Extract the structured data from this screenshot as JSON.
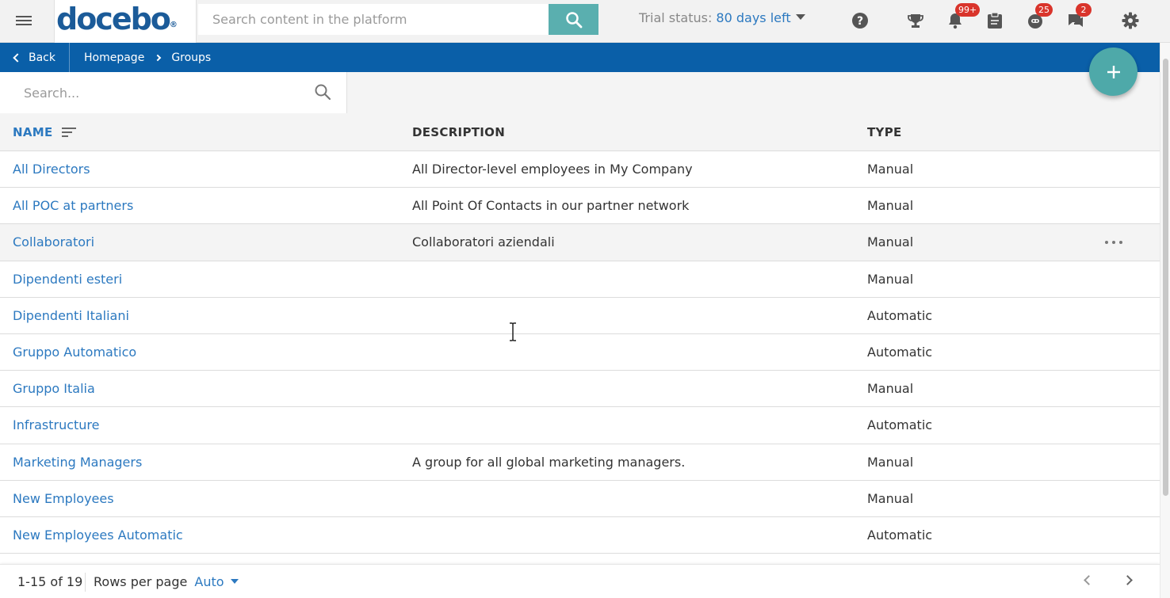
{
  "topbar": {
    "logo_text": "docebo",
    "logo_mark": "®",
    "search_placeholder": "Search content in the platform",
    "trial_prefix": "Trial status: ",
    "trial_days": "80 days left",
    "icons": [
      "menu-icon",
      "search-icon",
      "help-icon",
      "trophy-icon",
      "bell-icon",
      "clipboard-icon",
      "coach-icon",
      "chat-icon",
      "gear-icon"
    ],
    "badges": {
      "notifications": "99+",
      "coach": "25",
      "messages": "2"
    }
  },
  "breadcrumb": {
    "back_label": "Back",
    "items": [
      "Homepage",
      "Groups"
    ]
  },
  "filter": {
    "search_placeholder": "Search..."
  },
  "table": {
    "columns": {
      "name": "NAME",
      "description": "DESCRIPTION",
      "type": "TYPE"
    },
    "rows": [
      {
        "name": "All Directors",
        "description": "All Director-level employees in My Company",
        "type": "Manual"
      },
      {
        "name": "All POC at partners",
        "description": "All Point Of Contacts in our partner network",
        "type": "Manual"
      },
      {
        "name": "Collaboratori",
        "description": "Collaboratori aziendali",
        "type": "Manual"
      },
      {
        "name": "Dipendenti esteri",
        "description": "",
        "type": "Manual"
      },
      {
        "name": "Dipendenti Italiani",
        "description": "",
        "type": "Automatic"
      },
      {
        "name": "Gruppo Automatico",
        "description": "",
        "type": "Automatic"
      },
      {
        "name": "Gruppo Italia",
        "description": "",
        "type": "Manual"
      },
      {
        "name": "Infrastructure",
        "description": "",
        "type": "Automatic"
      },
      {
        "name": "Marketing Managers",
        "description": "A group for all global marketing managers.",
        "type": "Manual"
      },
      {
        "name": "New Employees",
        "description": "",
        "type": "Manual"
      },
      {
        "name": "New Employees Automatic",
        "description": "",
        "type": "Automatic"
      }
    ]
  },
  "footer": {
    "range": "1-15 of 19",
    "rows_per_page_label": "Rows per page",
    "rows_per_page_value": "Auto"
  },
  "colors": {
    "brand_blue": "#0a5fa8",
    "link_blue": "#2c79c0",
    "accent_teal": "#5aafaf",
    "badge_red": "#d9342b"
  }
}
